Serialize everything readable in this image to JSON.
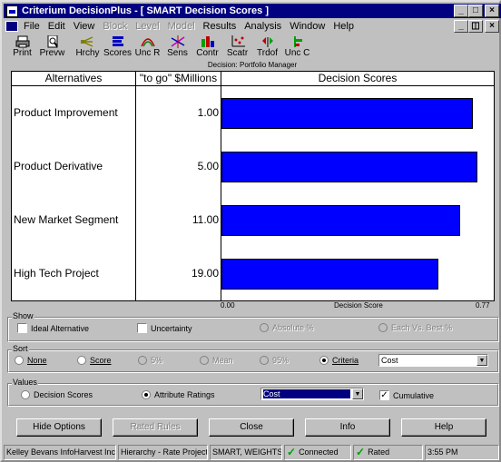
{
  "window": {
    "title": "Criterium DecisionPlus - [ SMART Decision Scores ]",
    "controls": [
      "_",
      "□",
      "×"
    ],
    "mdi_controls": [
      "_",
      "◫",
      "×"
    ]
  },
  "menu": [
    {
      "label": "File",
      "enabled": true
    },
    {
      "label": "Edit",
      "enabled": true
    },
    {
      "label": "View",
      "enabled": true
    },
    {
      "label": "Block",
      "enabled": false
    },
    {
      "label": "Level",
      "enabled": false
    },
    {
      "label": "Model",
      "enabled": false
    },
    {
      "label": "Results",
      "enabled": true
    },
    {
      "label": "Analysis",
      "enabled": true
    },
    {
      "label": "Window",
      "enabled": true
    },
    {
      "label": "Help",
      "enabled": true
    }
  ],
  "toolbar": [
    {
      "label": "Print",
      "icon": "printer-icon"
    },
    {
      "label": "Prevw",
      "icon": "preview-icon"
    },
    {
      "label": "Hrchy",
      "icon": "hierarchy-icon"
    },
    {
      "label": "Scores",
      "icon": "scores-icon"
    },
    {
      "label": "Unc R",
      "icon": "uncertainty-range-icon"
    },
    {
      "label": "Sens",
      "icon": "sensitivity-icon"
    },
    {
      "label": "Contr",
      "icon": "contributions-icon"
    },
    {
      "label": "Scatr",
      "icon": "scatter-icon"
    },
    {
      "label": "Trdof",
      "icon": "tradeoff-icon"
    },
    {
      "label": "Unc C",
      "icon": "uncertainty-criteria-icon"
    }
  ],
  "document_caption": "Decision: Portfolio Manager",
  "table": {
    "headers": {
      "alternatives": "Alternatives",
      "cost": "\"to go\" $Millions",
      "scores": "Decision Scores"
    },
    "axis": {
      "min_label": "0.00",
      "mid_label": "Decision Score",
      "max_label": "0.77"
    }
  },
  "chart_data": {
    "type": "bar",
    "orientation": "horizontal",
    "categories": [
      "Product Improvement",
      "Product Derivative",
      "New Market Segment",
      "High Tech Project"
    ],
    "cost_to_go": [
      "1.00",
      "5.00",
      "11.00",
      "19.00"
    ],
    "values": [
      0.705,
      0.72,
      0.67,
      0.61
    ],
    "xlim": [
      0.0,
      0.77
    ],
    "xlabel": "Decision Score",
    "bar_color": "#0000ff"
  },
  "show": {
    "legend": "Show",
    "ideal_alternative": {
      "label": "Ideal Alternative",
      "checked": false
    },
    "uncertainty": {
      "label": "Uncertainty",
      "checked": false
    },
    "absolute": {
      "label": "Absolute %",
      "enabled": false
    },
    "each_vs_best": {
      "label": "Each Vs. Best %",
      "enabled": false
    }
  },
  "sort": {
    "legend": "Sort",
    "options": [
      {
        "label": "None",
        "selected": false,
        "enabled": true
      },
      {
        "label": "Score",
        "selected": false,
        "enabled": true
      },
      {
        "label": "5%",
        "selected": false,
        "enabled": false
      },
      {
        "label": "Mean",
        "selected": false,
        "enabled": false
      },
      {
        "label": "95%",
        "selected": false,
        "enabled": false
      },
      {
        "label": "Criteria",
        "selected": true,
        "enabled": true
      }
    ],
    "criteria_value": "Cost"
  },
  "values": {
    "legend": "Values",
    "decision_scores": {
      "label": "Decision Scores",
      "selected": false
    },
    "attribute_ratings": {
      "label": "Attribute Ratings",
      "selected": true
    },
    "attribute_value": "Cost",
    "cumulative": {
      "label": "Cumulative",
      "checked": true
    }
  },
  "buttons": [
    {
      "label": "Hide Options",
      "enabled": true
    },
    {
      "label": "Rated Rules",
      "enabled": false
    },
    {
      "label": "Close",
      "enabled": true
    },
    {
      "label": "Info",
      "enabled": true
    },
    {
      "label": "Help",
      "enabled": true
    }
  ],
  "status": {
    "user": "Kelley Bevans InfoHarvest Inc.",
    "hierarchy": "Hierarchy - Rate Projects",
    "method": "SMART, WEIGHTS",
    "connected": "Connected",
    "rated": "Rated",
    "time": "3:55 PM"
  }
}
